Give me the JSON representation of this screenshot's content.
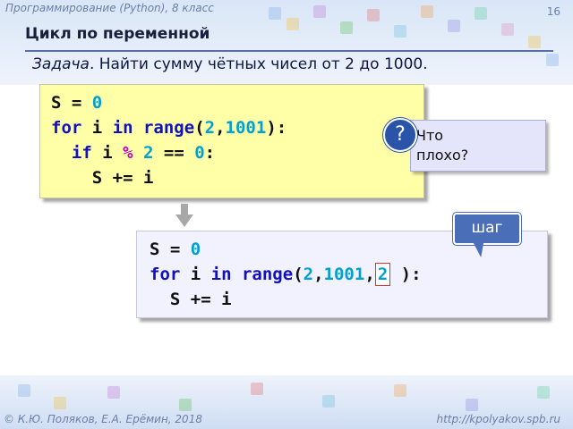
{
  "header": {
    "course": "Программирование (Python), 8 класс",
    "page_number": "16"
  },
  "slide": {
    "title": "Цикл по переменной",
    "task_label": "Задача",
    "task_text": ". Найти сумму чётных чисел от 2 до 1000."
  },
  "code1": {
    "line1": {
      "var": "S",
      "eq": " = ",
      "val": "0"
    },
    "line2": {
      "for": "for",
      "var": " i ",
      "in": "in",
      "range": " range",
      "open": "(",
      "a": "2",
      "comma": ",",
      "b": "1001",
      "close": "):"
    },
    "line3": {
      "indent": "  ",
      "if": "if",
      "var": " i ",
      "mod": "%",
      "two": " 2",
      "eqeq": " == ",
      "zero": "0",
      "colon": ":"
    },
    "line4": {
      "text": "    S += i"
    }
  },
  "question": {
    "mark": "?",
    "text_line1": " Что",
    "text_line2": "плохо?"
  },
  "callout": {
    "label": "шаг"
  },
  "code2": {
    "line1": {
      "var": "S",
      "eq": " = ",
      "val": "0"
    },
    "line2": {
      "for": "for",
      "var": " i ",
      "in": "in",
      "range": " range",
      "open": "(",
      "a": "2",
      "comma1": ",",
      "b": "1001",
      "comma2": ",",
      "step": "2",
      "close": " ):"
    },
    "line3": {
      "text": "  S += i"
    }
  },
  "footer": {
    "authors": "© К.Ю. Поляков, Е.А. Ерёмин, 2018",
    "url": "http://kpolyakov.spb.ru"
  },
  "colors": {
    "keyword": "#1010c0",
    "number": "#00a0d0",
    "modulo": "#c000c0",
    "box1_bg": "#ffffa8",
    "box2_bg": "#f2f2fe",
    "accent": "#2a54a8"
  },
  "icons": {
    "question": "question-mark-icon",
    "arrow": "down-arrow-icon"
  }
}
